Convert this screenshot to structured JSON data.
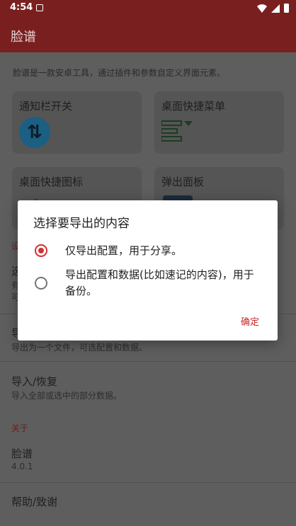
{
  "status": {
    "time": "4:54"
  },
  "app": {
    "title": "脸谱",
    "description": "脸谱是一款安卓工具，通过插件和参数自定义界面元素。"
  },
  "cards": [
    {
      "label": "通知栏开关"
    },
    {
      "label": "桌面快捷菜单"
    },
    {
      "label": "桌面快捷图标"
    },
    {
      "label": "弹出面板"
    }
  ],
  "partial_rows": {
    "settings_label_fragment": "设",
    "row1_title_fragment": "选",
    "row1_sub_fragment_1": "有",
    "row1_sub_fragment_2": "可",
    "export_title_fragment": "导",
    "export_sub": "导出为一个文件，可选配置和数据。"
  },
  "rows": {
    "import_title": "导入/恢复",
    "import_sub": "导入全部或选中的部分数据。",
    "about_section": "关于",
    "app_name": "脸谱",
    "version": "4.0.1",
    "help": "帮助/致谢"
  },
  "dialog": {
    "title": "选择要导出的内容",
    "options": [
      {
        "label": "仅导出配置，用于分享。",
        "checked": true
      },
      {
        "label": "导出配置和数据(比如速记的内容)，用于备份。",
        "checked": false
      }
    ],
    "confirm": "确定"
  },
  "colors": {
    "accent": "#d32f2f",
    "appbar": "#7a1f1f"
  }
}
